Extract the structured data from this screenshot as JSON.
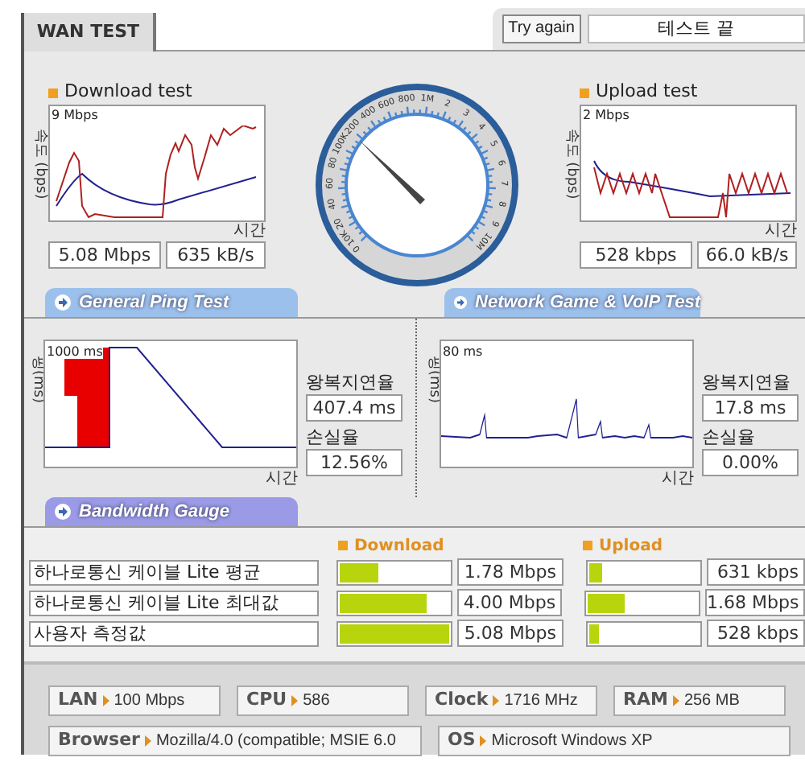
{
  "header": {
    "tab": "WAN TEST",
    "button": "Try again",
    "status": "테스트 끝"
  },
  "download": {
    "title": "Download test",
    "ylabel": "속도 (bps)",
    "max_label": "9 Mbps",
    "xlabel": "시간",
    "values": [
      "5.08 Mbps",
      "635 kB/s"
    ]
  },
  "gauge": {
    "labels": [
      "0 10K",
      "20",
      "40",
      "60",
      "80",
      "100K",
      "200",
      "400",
      "600",
      "800",
      "1M",
      "2",
      "3",
      "4",
      "5",
      "6",
      "7",
      "8",
      "9",
      "10M"
    ]
  },
  "upload": {
    "title": "Upload test",
    "ylabel": "속도 (bps)",
    "max_label": "2 Mbps",
    "xlabel": "시간",
    "values": [
      "528 kbps",
      "66.0 kB/s"
    ]
  },
  "ping_tests": [
    {
      "title": "General Ping Test",
      "ylabel": "핑(ms)",
      "max_label": "1000 ms",
      "xlabel": "시간",
      "latency_label": "왕복지연율",
      "latency": "407.4 ms",
      "loss_label": "손실율",
      "loss": "12.56%"
    },
    {
      "title": "Network Game & VoIP Test",
      "ylabel": "핑(ms)",
      "max_label": "80 ms",
      "xlabel": "시간",
      "latency_label": "왕복지연율",
      "latency": "17.8 ms",
      "loss_label": "손실율",
      "loss": "0.00%"
    }
  ],
  "bandwidth": {
    "title": "Bandwidth Gauge",
    "download_header": "Download",
    "upload_header": "Upload",
    "rows": [
      {
        "label": "하나로통신 케이블 Lite 평균",
        "download": {
          "level": 0.35,
          "value": "1.78 Mbps"
        },
        "upload": {
          "level": 0.12,
          "value": "631 kbps"
        }
      },
      {
        "label": "하나로통신 케이블 Lite 최대값",
        "download": {
          "level": 0.8,
          "value": "4.00 Mbps"
        },
        "upload": {
          "level": 0.34,
          "value": "1.68 Mbps"
        }
      },
      {
        "label": "사용자 측정값",
        "download": {
          "level": 1,
          "value": "5.08 Mbps"
        },
        "upload": {
          "level": 0.1,
          "value": "528 kbps"
        }
      }
    ]
  },
  "system_info": [
    {
      "label": "LAN",
      "value": "100 Mbps"
    },
    {
      "label": "CPU",
      "value": "586"
    },
    {
      "label": "Clock",
      "value": "1716 MHz"
    },
    {
      "label": "RAM",
      "value": "256 MB"
    },
    {
      "label": "Browser",
      "value": "Mozilla/4.0 (compatible; MSIE 6.0"
    },
    {
      "label": "OS",
      "value": "Microsoft Windows XP"
    }
  ]
}
